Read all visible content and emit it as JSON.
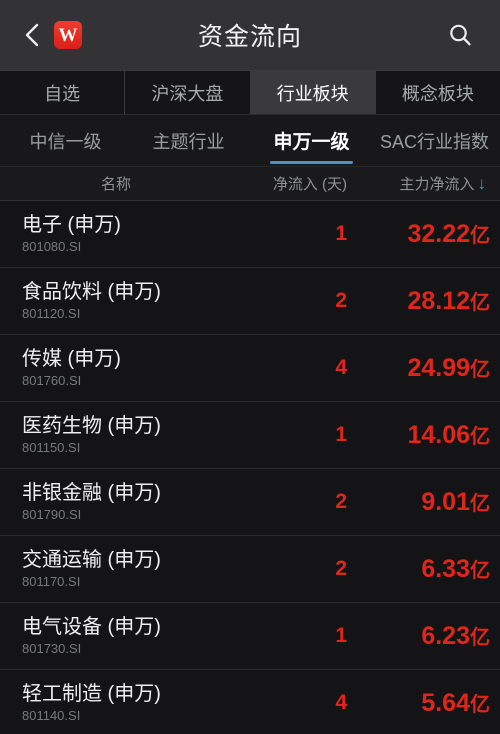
{
  "titlebar": {
    "back_icon": "chevron-left-icon",
    "logo_text": "W",
    "title": "资金流向",
    "search_icon": "search-icon"
  },
  "primary_tabs": [
    {
      "label": "自选",
      "active": false
    },
    {
      "label": "沪深大盘",
      "active": false
    },
    {
      "label": "行业板块",
      "active": true
    },
    {
      "label": "概念板块",
      "active": false
    }
  ],
  "secondary_tabs": [
    {
      "label": "中信一级",
      "active": false
    },
    {
      "label": "主题行业",
      "active": false
    },
    {
      "label": "申万一级",
      "active": true
    },
    {
      "label": "SAC行业指数",
      "active": false
    }
  ],
  "columns": {
    "name": "名称",
    "days": "净流入 (天)",
    "main_inflow": "主力净流入",
    "sort_arrow": "↓"
  },
  "colors": {
    "value_red": "#e0261a",
    "accent_blue": "#4a93c9",
    "logo_red": "#e5211b",
    "tab_active_bg": "#3a3a3c"
  },
  "rows": [
    {
      "name": "电子 (申万)",
      "code": "801080.SI",
      "days": "1",
      "value": "32.22",
      "unit": "亿"
    },
    {
      "name": "食品饮料 (申万)",
      "code": "801120.SI",
      "days": "2",
      "value": "28.12",
      "unit": "亿"
    },
    {
      "name": "传媒 (申万)",
      "code": "801760.SI",
      "days": "4",
      "value": "24.99",
      "unit": "亿"
    },
    {
      "name": "医药生物 (申万)",
      "code": "801150.SI",
      "days": "1",
      "value": "14.06",
      "unit": "亿"
    },
    {
      "name": "非银金融 (申万)",
      "code": "801790.SI",
      "days": "2",
      "value": "9.01",
      "unit": "亿"
    },
    {
      "name": "交通运输 (申万)",
      "code": "801170.SI",
      "days": "2",
      "value": "6.33",
      "unit": "亿"
    },
    {
      "name": "电气设备 (申万)",
      "code": "801730.SI",
      "days": "1",
      "value": "6.23",
      "unit": "亿"
    },
    {
      "name": "轻工制造 (申万)",
      "code": "801140.SI",
      "days": "4",
      "value": "5.64",
      "unit": "亿"
    }
  ]
}
